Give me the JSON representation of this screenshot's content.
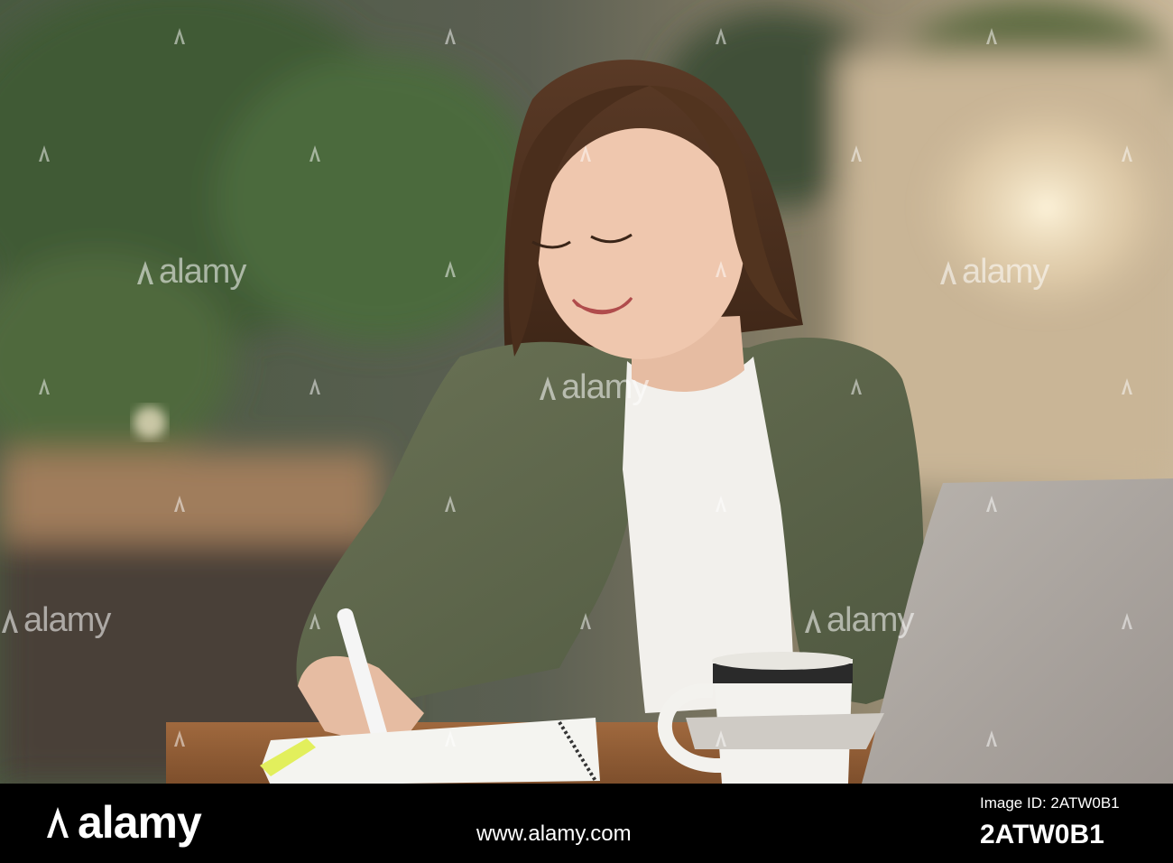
{
  "watermark": {
    "text": "alamy",
    "color": "#ffffff"
  },
  "footer": {
    "logo_text": "alamy",
    "site": "www.alamy.com",
    "image_id_label": "Image ID: 2ATW0B1",
    "image_id": "2ATW0B1",
    "background": "#000000"
  },
  "scene": {
    "subject": "young woman writing in a notebook",
    "objects": [
      "notebook",
      "pen",
      "coffee mug",
      "laptop",
      "wooden table",
      "plants"
    ]
  }
}
